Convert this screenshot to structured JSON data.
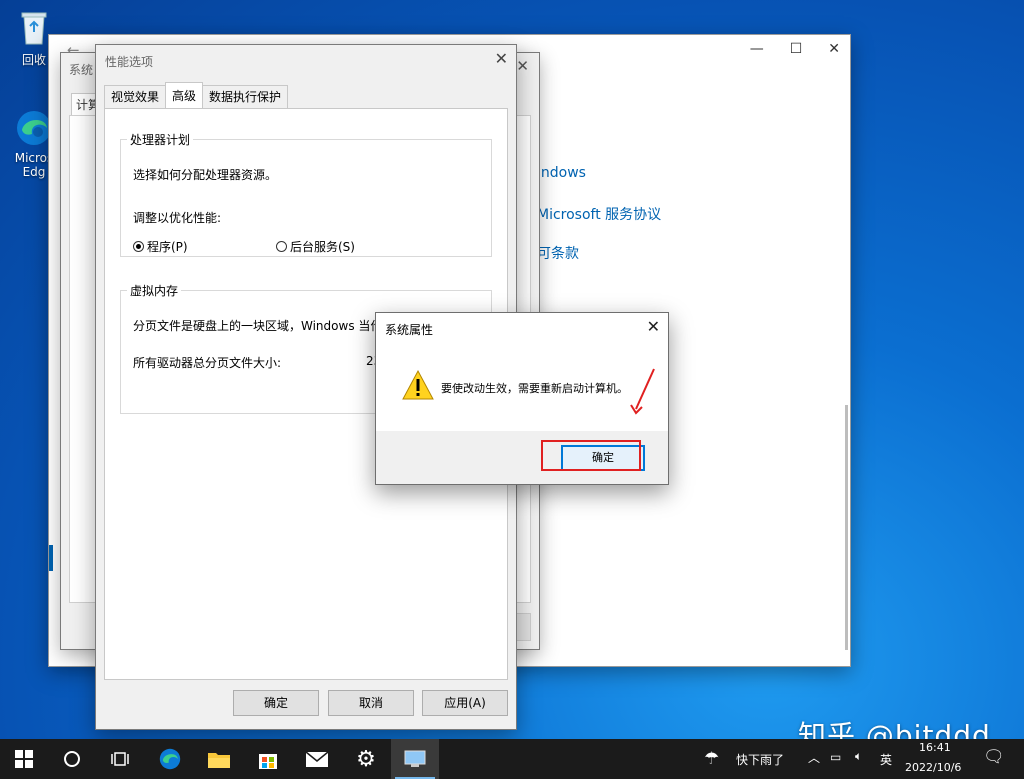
{
  "desktop": {
    "icons": [
      {
        "label": "回收"
      },
      {
        "label": "Micros\nEdg"
      }
    ]
  },
  "settings_window": {
    "links": [
      "indows",
      "Microsoft 服务协议",
      "可条款"
    ]
  },
  "sysprop_back": {
    "title": "系统",
    "tab": "计算"
  },
  "perf_options": {
    "title": "性能选项",
    "tabs": [
      "视觉效果",
      "高级",
      "数据执行保护"
    ],
    "cpu_group": {
      "legend": "处理器计划",
      "desc": "选择如何分配处理器资源。",
      "adjust_label": "调整以优化性能:",
      "options": [
        {
          "label": "程序(P)",
          "checked": true
        },
        {
          "label": "后台服务(S)",
          "checked": false
        }
      ]
    },
    "vm_group": {
      "legend": "虚拟内存",
      "desc": "分页文件是硬盘上的一块区域，Windows 当作 RAM 使用",
      "total_label": "所有驱动器总分页文件大小:",
      "total_value": "23"
    },
    "buttons": {
      "ok": "确定",
      "cancel": "取消",
      "apply": "应用(A)"
    }
  },
  "message_dialog": {
    "title": "系统属性",
    "message": "要使改动生效，需要重新启动计算机。",
    "ok": "确定"
  },
  "taskbar": {
    "weather": "快下雨了",
    "ime": "英",
    "time": "16:41",
    "date": "2022/10/6"
  },
  "watermark": "知乎 @bitddd",
  "colors": {
    "accent": "#0078d7",
    "link": "#0063b1",
    "highlight_red": "#e02020"
  }
}
